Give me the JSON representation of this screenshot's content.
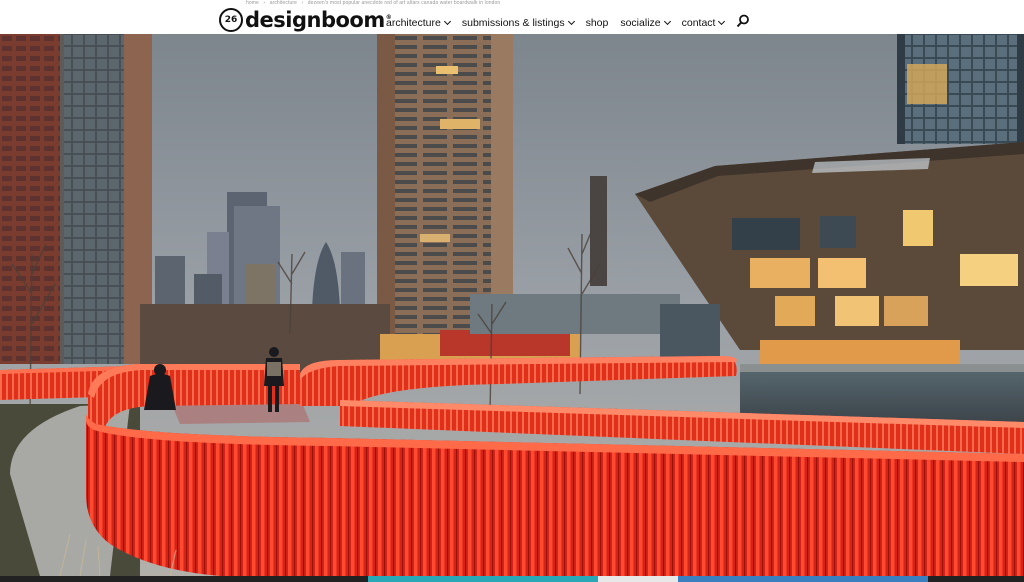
{
  "breadcrumb": [
    "home",
    "architecture",
    "dezeen's most popular anecdote red of art altars canada water boardwalk in london"
  ],
  "logo": {
    "badge": "26",
    "name": "designboom",
    "reg": "®"
  },
  "nav": [
    {
      "label": "architecture",
      "dropdown": true
    },
    {
      "label": "submissions & listings",
      "dropdown": true
    },
    {
      "label": "shop",
      "dropdown": false
    },
    {
      "label": "socialize",
      "dropdown": true
    },
    {
      "label": "contact",
      "dropdown": true
    }
  ],
  "icons": {
    "search": "search-icon",
    "chevron": "chevron-down-icon"
  },
  "colors": {
    "bridge": "#e5281c",
    "sky": "#8f969d",
    "building": "#6a5442",
    "text": "#111111"
  }
}
